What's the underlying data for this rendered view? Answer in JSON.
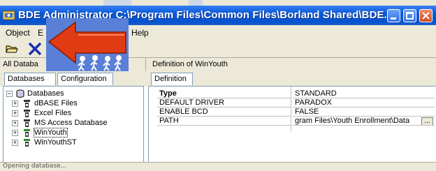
{
  "window": {
    "title": "BDE Administrator  C:\\Program Files\\Common Files\\Borland Shared\\BDE...",
    "controls": {
      "minimize": "minimize-button",
      "maximize": "maximize-button",
      "close": "close-button"
    }
  },
  "menu": {
    "items": [
      "Object",
      "E",
      "Help"
    ]
  },
  "toolbar": {
    "icons": [
      "open-folder-icon",
      "delete-x-icon"
    ]
  },
  "pathbar": {
    "left": "All Databa",
    "right": "Definition of WinYouth"
  },
  "tabs": {
    "left": [
      "Databases",
      "Configuration"
    ],
    "right": [
      "Definition"
    ]
  },
  "tree": {
    "root": "Databases",
    "items": [
      "dBASE Files",
      "Excel Files",
      "MS Access Database",
      "WinYouth",
      "WinYouthST"
    ]
  },
  "definition": {
    "rows": [
      {
        "key": "Type",
        "value": "STANDARD",
        "bold": true
      },
      {
        "key": "DEFAULT DRIVER",
        "value": "PARADOX",
        "bold": false
      },
      {
        "key": "ENABLE BCD",
        "value": "FALSE",
        "bold": false
      },
      {
        "key": "PATH",
        "value": "gram Files\\Youth Enrollment\\Data",
        "bold": false
      }
    ],
    "ellipsis": "..."
  },
  "status": {
    "text": "Opening database..."
  },
  "colors": {
    "title_bar": "#0653d0",
    "chrome": "#ece9d8",
    "overlay_bg": "#5a7fd6",
    "arrow": "#e03b12"
  }
}
